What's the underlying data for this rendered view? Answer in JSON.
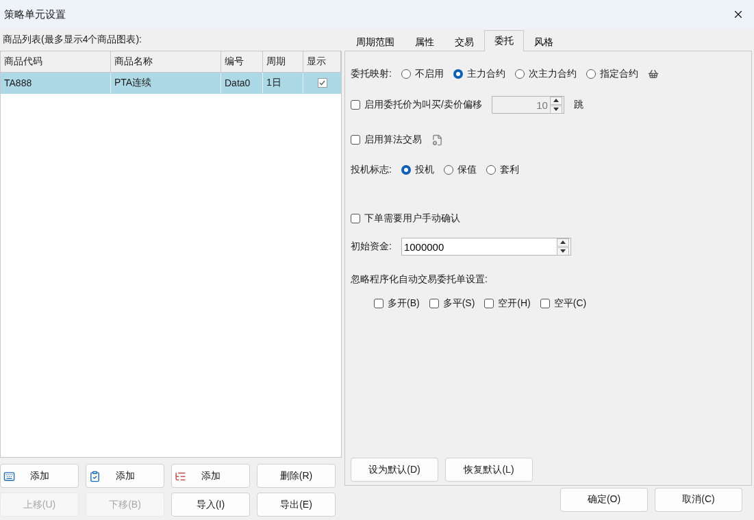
{
  "window": {
    "title": "策略单元设置"
  },
  "product_list": {
    "label": "商品列表(最多显示4个商品图表):",
    "columns": [
      "商品代码",
      "商品名称",
      "编号",
      "周期",
      "显示"
    ],
    "rows": [
      {
        "code": "TA888",
        "name": "PTA连续",
        "number": "Data0",
        "period": "1日",
        "show": true,
        "selected": true
      }
    ]
  },
  "list_buttons": [
    {
      "label": "添加",
      "kind": "keyboard",
      "disabled": false
    },
    {
      "label": "添加",
      "kind": "clipboard",
      "disabled": false
    },
    {
      "label": "添加",
      "kind": "tree",
      "disabled": false
    },
    {
      "label": "删除(R)",
      "kind": "plain",
      "disabled": false
    },
    {
      "label": "上移(U)",
      "kind": "plain",
      "disabled": true
    },
    {
      "label": "下移(B)",
      "kind": "plain",
      "disabled": true
    },
    {
      "label": "导入(I)",
      "kind": "plain",
      "disabled": false
    },
    {
      "label": "导出(E)",
      "kind": "plain",
      "disabled": false
    }
  ],
  "tabs": [
    {
      "label": "周期范围",
      "selected": false
    },
    {
      "label": "属性",
      "selected": false
    },
    {
      "label": "交易",
      "selected": false
    },
    {
      "label": "委托",
      "selected": true
    },
    {
      "label": "风格",
      "selected": false
    }
  ],
  "order_mapping": {
    "label": "委托映射:",
    "options": [
      {
        "label": "不启用",
        "selected": false
      },
      {
        "label": "主力合约",
        "selected": true
      },
      {
        "label": "次主力合约",
        "selected": false
      },
      {
        "label": "指定合约",
        "selected": false
      }
    ]
  },
  "price_offset": {
    "label": "启用委托价为叫买/卖价偏移",
    "checked": false,
    "value": "10",
    "unit": "跳"
  },
  "algo_trading": {
    "label": "启用算法交易",
    "checked": false
  },
  "hedge_flag": {
    "label": "投机标志:",
    "options": [
      {
        "label": "投机",
        "selected": true
      },
      {
        "label": "保值",
        "selected": false
      },
      {
        "label": "套利",
        "selected": false
      }
    ]
  },
  "manual_confirm": {
    "label": "下单需要用户手动确认",
    "checked": false
  },
  "initial_capital": {
    "label": "初始资金:",
    "value": "1000000"
  },
  "ignore_settings": {
    "label": "忽略程序化自动交易委托单设置:",
    "options": [
      {
        "label": "多开(B)",
        "checked": false
      },
      {
        "label": "多平(S)",
        "checked": false
      },
      {
        "label": "空开(H)",
        "checked": false
      },
      {
        "label": "空平(C)",
        "checked": false
      }
    ]
  },
  "panel_buttons": [
    "设为默认(D)",
    "恢复默认(L)"
  ],
  "dialog_buttons": [
    "确定(O)",
    "取消(C)"
  ]
}
